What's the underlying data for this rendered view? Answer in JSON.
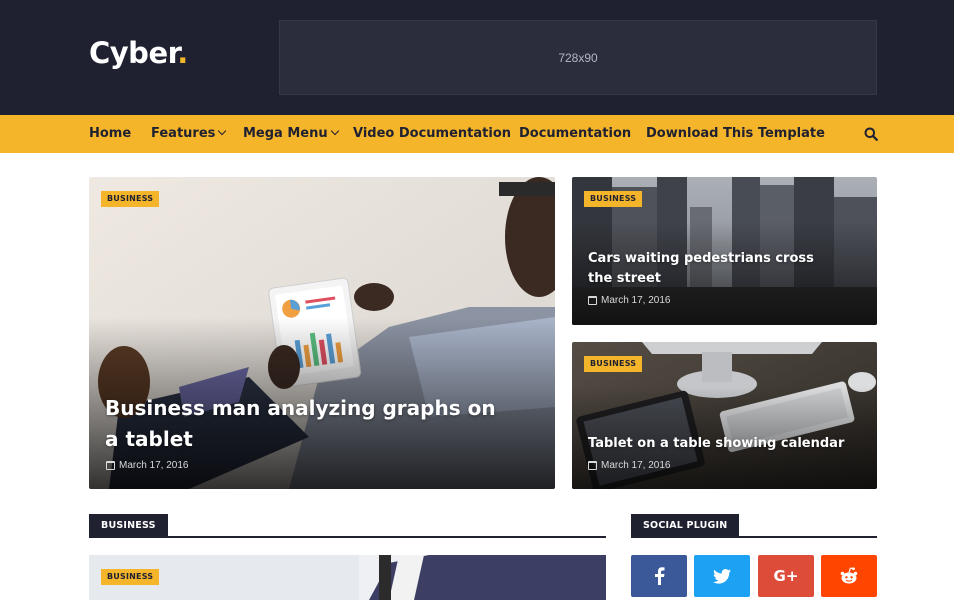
{
  "header": {
    "logo_text": "Cyber",
    "logo_dot": ".",
    "ad_label": "728x90"
  },
  "nav": {
    "items": [
      {
        "label": "Home",
        "dropdown": false
      },
      {
        "label": "Features",
        "dropdown": true
      },
      {
        "label": "Mega Menu",
        "dropdown": true
      },
      {
        "label": "Video Documentation",
        "dropdown": false
      },
      {
        "label": "Documentation",
        "dropdown": false
      },
      {
        "label": "Download This Template",
        "dropdown": false
      }
    ],
    "search_icon": "search-icon"
  },
  "featured": [
    {
      "category": "BUSINESS",
      "title": "Business man analyzing graphs on a tablet",
      "date": "March 17, 2016"
    },
    {
      "category": "BUSINESS",
      "title": "Cars waiting pedestrians cross the street",
      "date": "March 17, 2016"
    },
    {
      "category": "BUSINESS",
      "title": "Tablet on a table showing calendar",
      "date": "March 17, 2016"
    }
  ],
  "sections": {
    "business_title": "BUSINESS",
    "business_post_category": "BUSINESS",
    "social_title": "SOCIAL PLUGIN"
  },
  "social": [
    {
      "name": "facebook",
      "glyph": "f",
      "color": "#3b5998"
    },
    {
      "name": "twitter",
      "glyph": "t",
      "color": "#1da1f2"
    },
    {
      "name": "google-plus",
      "glyph": "G+",
      "color": "#dd4b39"
    },
    {
      "name": "reddit",
      "glyph": "r",
      "color": "#ff4500"
    }
  ],
  "colors": {
    "accent": "#f5b52a",
    "dark": "#1f2030"
  }
}
